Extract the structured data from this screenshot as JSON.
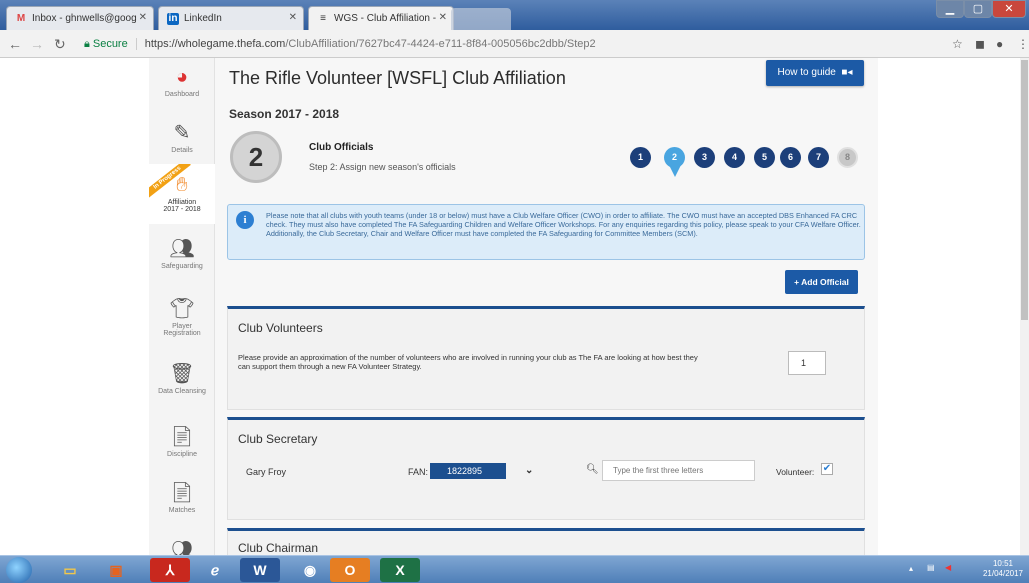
{
  "browser": {
    "tabs": [
      {
        "title": "Inbox - ghnwells@goog",
        "favicon": "M"
      },
      {
        "title": "LinkedIn",
        "favicon": "in"
      },
      {
        "title": "WGS - Club Affiliation -",
        "favicon": "≡"
      }
    ],
    "secure_label": "Secure",
    "url_host": "https://wholegame.thefa.com",
    "url_path": "/ClubAffiliation/7627bc47-4424-e711-8f84-005056bc2dbb/Step2"
  },
  "sidebar": {
    "items": [
      {
        "label": "Dashboard",
        "icon": "dashboard-icon"
      },
      {
        "label": "Details",
        "icon": "pencil-icon"
      },
      {
        "label": "Affiliation 2017 - 2018",
        "icon": "handshake-icon",
        "ribbon": "In Progress"
      },
      {
        "label": "Safeguarding",
        "icon": "people-icon"
      },
      {
        "label": "Player Registration",
        "icon": "shirt-icon"
      },
      {
        "label": "Data Cleansing",
        "icon": "bucket-icon"
      },
      {
        "label": "Discipline",
        "icon": "document-icon"
      },
      {
        "label": "Matches",
        "icon": "document-icon"
      }
    ]
  },
  "main": {
    "title": "The Rifle Volunteer [WSFL] Club Affiliation",
    "guide_button": "How to guide",
    "season": "Season 2017 - 2018",
    "step": {
      "number": "2",
      "title": "Club Officials",
      "subtitle": "Step 2: Assign new season's officials",
      "steps": [
        "1",
        "2",
        "3",
        "4",
        "5",
        "6",
        "7",
        "8"
      ],
      "current": 2
    },
    "info": "Please note that all clubs with youth teams (under 18 or below) must have a Club Welfare Officer (CWO) in order to affiliate. The CWO must have an accepted DBS Enhanced FA CRC check. They must also have completed The FA Safeguarding Children and Welfare Officer Workshops. For any enquiries regarding this policy, please speak to your CFA Welfare Officer. Additionally, the Club Secretary, Chair and Welfare Officer must have completed the FA Safeguarding for Committee Members (SCM).",
    "add_official": "+ Add Official",
    "volunteers": {
      "title": "Club Volunteers",
      "text": "Please provide an approximation of the number of volunteers who are involved in running your club as The FA are looking at how best they can support them through a new FA Volunteer Strategy.",
      "value": "1"
    },
    "secretary": {
      "title": "Club Secretary",
      "name": "Gary Froy",
      "fan_label": "FAN:",
      "fan_value": "1822895",
      "search_placeholder": "Type the first three letters",
      "volunteer_label": "Volunteer:",
      "volunteer_checked": true
    },
    "chairman": {
      "title": "Club Chairman"
    }
  },
  "taskbar": {
    "time": "10:51",
    "date": "21/04/2017"
  },
  "colors": {
    "brand_blue": "#1c5aa6",
    "navy": "#1c3f7a",
    "step_current": "#49a5e0"
  }
}
